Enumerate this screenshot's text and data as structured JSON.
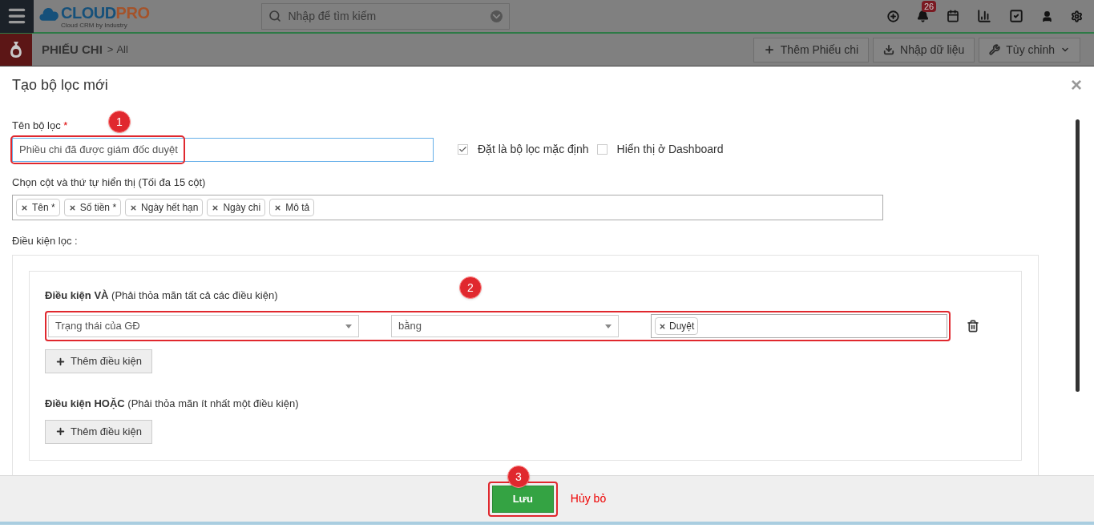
{
  "header": {
    "logo": {
      "main": "CLOUD",
      "accent": "PRO",
      "tagline": "Cloud CRM by Industry"
    },
    "search": {
      "placeholder": "Nhập để tìm kiếm"
    },
    "notification_count": "26"
  },
  "subbar": {
    "module": "PHIẾU CHI",
    "separator": ">",
    "view": "All",
    "buttons": [
      {
        "label": "Thêm Phiếu chi",
        "dropdown": false
      },
      {
        "label": "Nhập dữ liệu",
        "dropdown": false
      },
      {
        "label": "Tùy chỉnh",
        "dropdown": true
      }
    ]
  },
  "dialog": {
    "title": "Tạo bộ lọc mới",
    "close": "×",
    "name_field": {
      "label": "Tên bộ lọc",
      "required_mark": "*",
      "value": "Phiều chi đã được giám đốc duyệt"
    },
    "options": [
      {
        "label": "Đặt là bộ lọc mặc định",
        "checked": true
      },
      {
        "label": "Hiển thị ở Dashboard",
        "checked": false
      }
    ],
    "columns_field": {
      "label": "Chọn cột và thứ tự hiển thị (Tối đa 15 cột)",
      "tags": [
        "Tên *",
        "Số tiền *",
        "Ngày hết hạn",
        "Ngày chi",
        "Mô tả"
      ]
    },
    "conditions_label": "Điều kiện lọc :",
    "groups": [
      {
        "title": "Điều kiện VÀ",
        "hint": "(Phải thỏa mãn tất cả các điều kiện)",
        "rows": [
          {
            "field": "Trạng thái của GĐ",
            "operator": "bằng",
            "values": [
              "Duyệt"
            ]
          }
        ],
        "add_button": "Thêm điều kiện"
      },
      {
        "title": "Điều kiện HOẶC",
        "hint": "(Phải thỏa mãn ít nhất một điều kiện)",
        "add_button": "Thêm điều kiện"
      }
    ],
    "footer": {
      "save": "Lưu",
      "cancel": "Hủy bỏ"
    }
  },
  "annotations": [
    "1",
    "2",
    "3"
  ]
}
